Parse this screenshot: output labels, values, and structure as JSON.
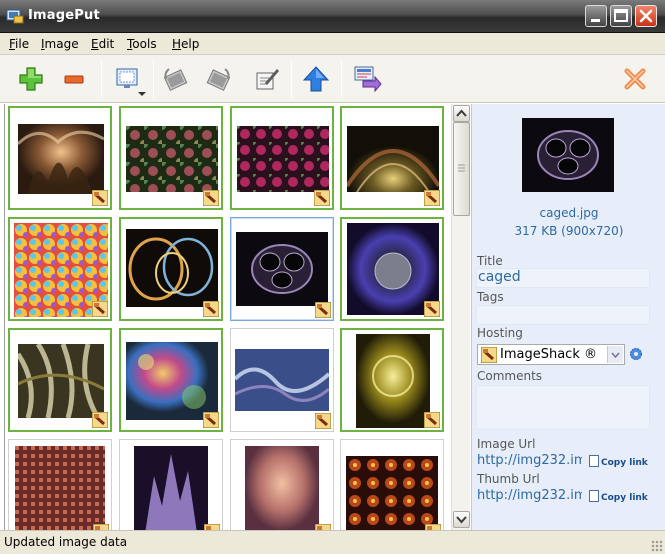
{
  "window": {
    "title": "ImagePut"
  },
  "menu": [
    {
      "first": "F",
      "rest": "ile"
    },
    {
      "first": "I",
      "rest": "mage"
    },
    {
      "first": "E",
      "rest": "dit"
    },
    {
      "first": "T",
      "rest": "ools"
    },
    {
      "first": "H",
      "rest": "elp"
    }
  ],
  "toolbar": {
    "icons": [
      "add-icon",
      "remove-icon",
      "view-mode-icon",
      "rotate-left-icon",
      "rotate-right-icon",
      "edit-icon",
      "upload-icon",
      "export-icon",
      "clear-icon"
    ]
  },
  "thumbnails": [
    {
      "status": "uploaded"
    },
    {
      "status": "uploaded"
    },
    {
      "status": "uploaded"
    },
    {
      "status": "uploaded"
    },
    {
      "status": "uploaded"
    },
    {
      "status": "uploaded"
    },
    {
      "status": "selected"
    },
    {
      "status": "uploaded"
    },
    {
      "status": "uploaded"
    },
    {
      "status": "uploaded"
    },
    {
      "status": "pending"
    },
    {
      "status": "uploaded"
    },
    {
      "status": "pending"
    },
    {
      "status": "pending"
    },
    {
      "status": "pending"
    },
    {
      "status": "pending"
    }
  ],
  "details": {
    "filename": "caged.jpg",
    "fileinfo": "317 KB (900x720)",
    "title_label": "Title",
    "title_value": "caged",
    "tags_label": "Tags",
    "tags_value": "",
    "hosting_label": "Hosting",
    "hosting_value": "ImageShack ®",
    "comments_label": "Comments",
    "comments_value": "",
    "image_url_label": "Image Url",
    "image_url": "http://img232.im",
    "thumb_url_label": "Thumb Url",
    "thumb_url": "http://img232.im",
    "copy_link": "Copy link"
  },
  "status": {
    "text": "Updated image data"
  },
  "colors": {
    "uploaded_border": "#6cb33f",
    "selected_border": "#7aa7e0",
    "link": "#2c6aa0"
  }
}
